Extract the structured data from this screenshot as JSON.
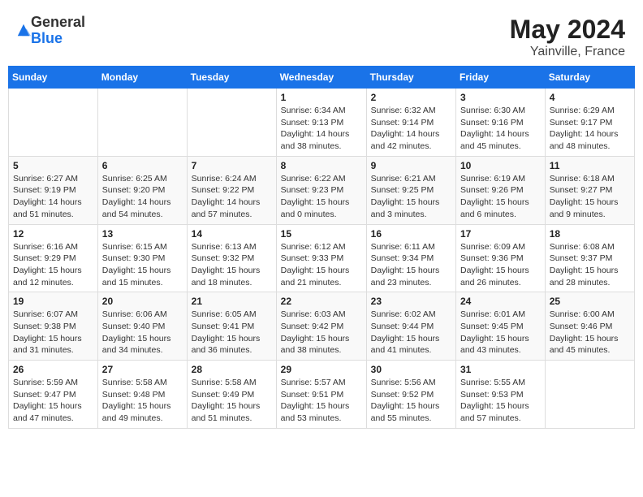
{
  "header": {
    "logo_general": "General",
    "logo_blue": "Blue",
    "month_year": "May 2024",
    "location": "Yainville, France"
  },
  "weekdays": [
    "Sunday",
    "Monday",
    "Tuesday",
    "Wednesday",
    "Thursday",
    "Friday",
    "Saturday"
  ],
  "weeks": [
    [
      {
        "day": "",
        "info": ""
      },
      {
        "day": "",
        "info": ""
      },
      {
        "day": "",
        "info": ""
      },
      {
        "day": "1",
        "sunrise": "Sunrise: 6:34 AM",
        "sunset": "Sunset: 9:13 PM",
        "daylight": "Daylight: 14 hours and 38 minutes."
      },
      {
        "day": "2",
        "sunrise": "Sunrise: 6:32 AM",
        "sunset": "Sunset: 9:14 PM",
        "daylight": "Daylight: 14 hours and 42 minutes."
      },
      {
        "day": "3",
        "sunrise": "Sunrise: 6:30 AM",
        "sunset": "Sunset: 9:16 PM",
        "daylight": "Daylight: 14 hours and 45 minutes."
      },
      {
        "day": "4",
        "sunrise": "Sunrise: 6:29 AM",
        "sunset": "Sunset: 9:17 PM",
        "daylight": "Daylight: 14 hours and 48 minutes."
      }
    ],
    [
      {
        "day": "5",
        "sunrise": "Sunrise: 6:27 AM",
        "sunset": "Sunset: 9:19 PM",
        "daylight": "Daylight: 14 hours and 51 minutes."
      },
      {
        "day": "6",
        "sunrise": "Sunrise: 6:25 AM",
        "sunset": "Sunset: 9:20 PM",
        "daylight": "Daylight: 14 hours and 54 minutes."
      },
      {
        "day": "7",
        "sunrise": "Sunrise: 6:24 AM",
        "sunset": "Sunset: 9:22 PM",
        "daylight": "Daylight: 14 hours and 57 minutes."
      },
      {
        "day": "8",
        "sunrise": "Sunrise: 6:22 AM",
        "sunset": "Sunset: 9:23 PM",
        "daylight": "Daylight: 15 hours and 0 minutes."
      },
      {
        "day": "9",
        "sunrise": "Sunrise: 6:21 AM",
        "sunset": "Sunset: 9:25 PM",
        "daylight": "Daylight: 15 hours and 3 minutes."
      },
      {
        "day": "10",
        "sunrise": "Sunrise: 6:19 AM",
        "sunset": "Sunset: 9:26 PM",
        "daylight": "Daylight: 15 hours and 6 minutes."
      },
      {
        "day": "11",
        "sunrise": "Sunrise: 6:18 AM",
        "sunset": "Sunset: 9:27 PM",
        "daylight": "Daylight: 15 hours and 9 minutes."
      }
    ],
    [
      {
        "day": "12",
        "sunrise": "Sunrise: 6:16 AM",
        "sunset": "Sunset: 9:29 PM",
        "daylight": "Daylight: 15 hours and 12 minutes."
      },
      {
        "day": "13",
        "sunrise": "Sunrise: 6:15 AM",
        "sunset": "Sunset: 9:30 PM",
        "daylight": "Daylight: 15 hours and 15 minutes."
      },
      {
        "day": "14",
        "sunrise": "Sunrise: 6:13 AM",
        "sunset": "Sunset: 9:32 PM",
        "daylight": "Daylight: 15 hours and 18 minutes."
      },
      {
        "day": "15",
        "sunrise": "Sunrise: 6:12 AM",
        "sunset": "Sunset: 9:33 PM",
        "daylight": "Daylight: 15 hours and 21 minutes."
      },
      {
        "day": "16",
        "sunrise": "Sunrise: 6:11 AM",
        "sunset": "Sunset: 9:34 PM",
        "daylight": "Daylight: 15 hours and 23 minutes."
      },
      {
        "day": "17",
        "sunrise": "Sunrise: 6:09 AM",
        "sunset": "Sunset: 9:36 PM",
        "daylight": "Daylight: 15 hours and 26 minutes."
      },
      {
        "day": "18",
        "sunrise": "Sunrise: 6:08 AM",
        "sunset": "Sunset: 9:37 PM",
        "daylight": "Daylight: 15 hours and 28 minutes."
      }
    ],
    [
      {
        "day": "19",
        "sunrise": "Sunrise: 6:07 AM",
        "sunset": "Sunset: 9:38 PM",
        "daylight": "Daylight: 15 hours and 31 minutes."
      },
      {
        "day": "20",
        "sunrise": "Sunrise: 6:06 AM",
        "sunset": "Sunset: 9:40 PM",
        "daylight": "Daylight: 15 hours and 34 minutes."
      },
      {
        "day": "21",
        "sunrise": "Sunrise: 6:05 AM",
        "sunset": "Sunset: 9:41 PM",
        "daylight": "Daylight: 15 hours and 36 minutes."
      },
      {
        "day": "22",
        "sunrise": "Sunrise: 6:03 AM",
        "sunset": "Sunset: 9:42 PM",
        "daylight": "Daylight: 15 hours and 38 minutes."
      },
      {
        "day": "23",
        "sunrise": "Sunrise: 6:02 AM",
        "sunset": "Sunset: 9:44 PM",
        "daylight": "Daylight: 15 hours and 41 minutes."
      },
      {
        "day": "24",
        "sunrise": "Sunrise: 6:01 AM",
        "sunset": "Sunset: 9:45 PM",
        "daylight": "Daylight: 15 hours and 43 minutes."
      },
      {
        "day": "25",
        "sunrise": "Sunrise: 6:00 AM",
        "sunset": "Sunset: 9:46 PM",
        "daylight": "Daylight: 15 hours and 45 minutes."
      }
    ],
    [
      {
        "day": "26",
        "sunrise": "Sunrise: 5:59 AM",
        "sunset": "Sunset: 9:47 PM",
        "daylight": "Daylight: 15 hours and 47 minutes."
      },
      {
        "day": "27",
        "sunrise": "Sunrise: 5:58 AM",
        "sunset": "Sunset: 9:48 PM",
        "daylight": "Daylight: 15 hours and 49 minutes."
      },
      {
        "day": "28",
        "sunrise": "Sunrise: 5:58 AM",
        "sunset": "Sunset: 9:49 PM",
        "daylight": "Daylight: 15 hours and 51 minutes."
      },
      {
        "day": "29",
        "sunrise": "Sunrise: 5:57 AM",
        "sunset": "Sunset: 9:51 PM",
        "daylight": "Daylight: 15 hours and 53 minutes."
      },
      {
        "day": "30",
        "sunrise": "Sunrise: 5:56 AM",
        "sunset": "Sunset: 9:52 PM",
        "daylight": "Daylight: 15 hours and 55 minutes."
      },
      {
        "day": "31",
        "sunrise": "Sunrise: 5:55 AM",
        "sunset": "Sunset: 9:53 PM",
        "daylight": "Daylight: 15 hours and 57 minutes."
      },
      {
        "day": "",
        "info": ""
      }
    ]
  ]
}
